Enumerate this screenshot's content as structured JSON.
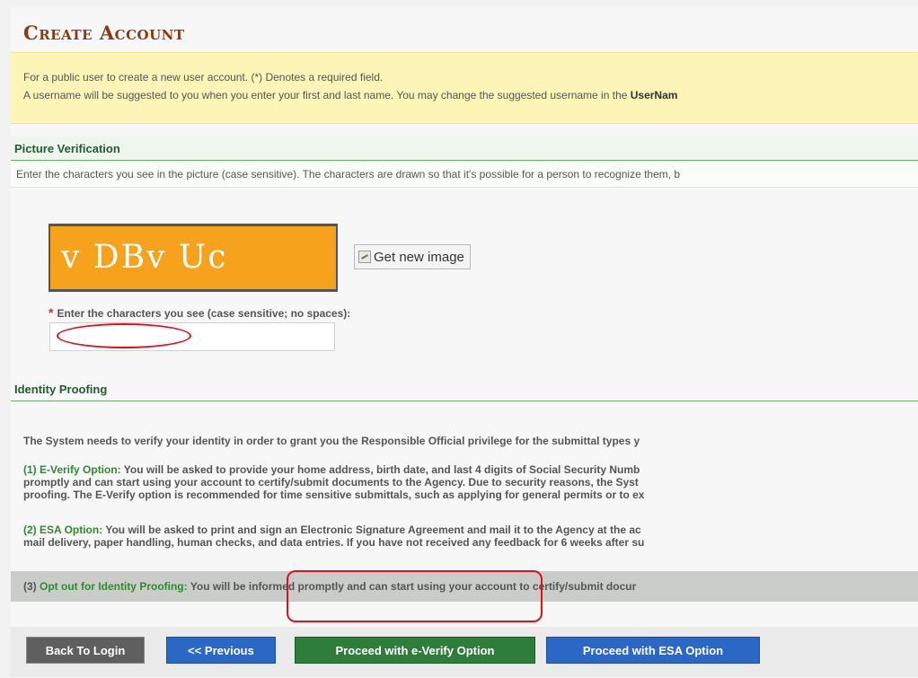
{
  "header": {
    "title": "Create Account"
  },
  "notice": {
    "line1": "For a public user to create a new user account. (*) Denotes a required field.",
    "line2_prefix": "A username will be suggested to you when you enter your first and last name. You may change the suggested username in the ",
    "line2_bold": "UserNam"
  },
  "picture_verification": {
    "heading": "Picture Verification",
    "description": "Enter the characters you see in the picture (case sensitive). The characters are drawn so that it's possible for a person to recognize them, b",
    "captcha_text": "v DBv Uc",
    "new_image_label": "Get new image",
    "required_marker": "*",
    "field_label": "Enter the characters you see (case sensitive; no spaces):",
    "field_value": ""
  },
  "identity_proofing": {
    "heading": "Identity Proofing",
    "intro": "The System needs to verify your identity in order to grant you the Responsible Official privilege for the submittal types y",
    "option1_title": "(1) E-Verify Option:",
    "option1_line1": " You will be asked to provide your home address, birth date, and last 4 digits of Social Security Numb",
    "option1_line2": "promptly and can start using your account to certify/submit documents to the Agency. Due to security reasons, the Syst",
    "option1_line3": "proofing. The E-Verify option is recommended for time sensitive submittals, such as applying for general permits or to ex",
    "option2_title": "(2) ESA Option:",
    "option2_line1": " You will be asked to print and sign an Electronic Signature Agreement and mail it to the Agency at the ac",
    "option2_line2": "mail delivery, paper handling, human checks, and data entries. If you have not received any feedback for 6 weeks after su",
    "option3_prefix": "(3) ",
    "option3_title": "Opt out for Identity Proofing:",
    "option3_text": " You will be informed promptly and can start using your account to certify/submit docur"
  },
  "buttons": {
    "back": "Back To Login",
    "previous": "<< Previous",
    "everify": "Proceed with e-Verify Option",
    "esa": "Proceed with ESA Option"
  },
  "colors": {
    "title": "#8a3a10",
    "notice_bg": "#fdf4b8",
    "section_heading": "#1f5c2e",
    "captcha_bg": "#f6a21c",
    "highlight_ring": "#e0101e",
    "everify_button": "#2f7d3a",
    "blue_button": "#2b68c6"
  }
}
